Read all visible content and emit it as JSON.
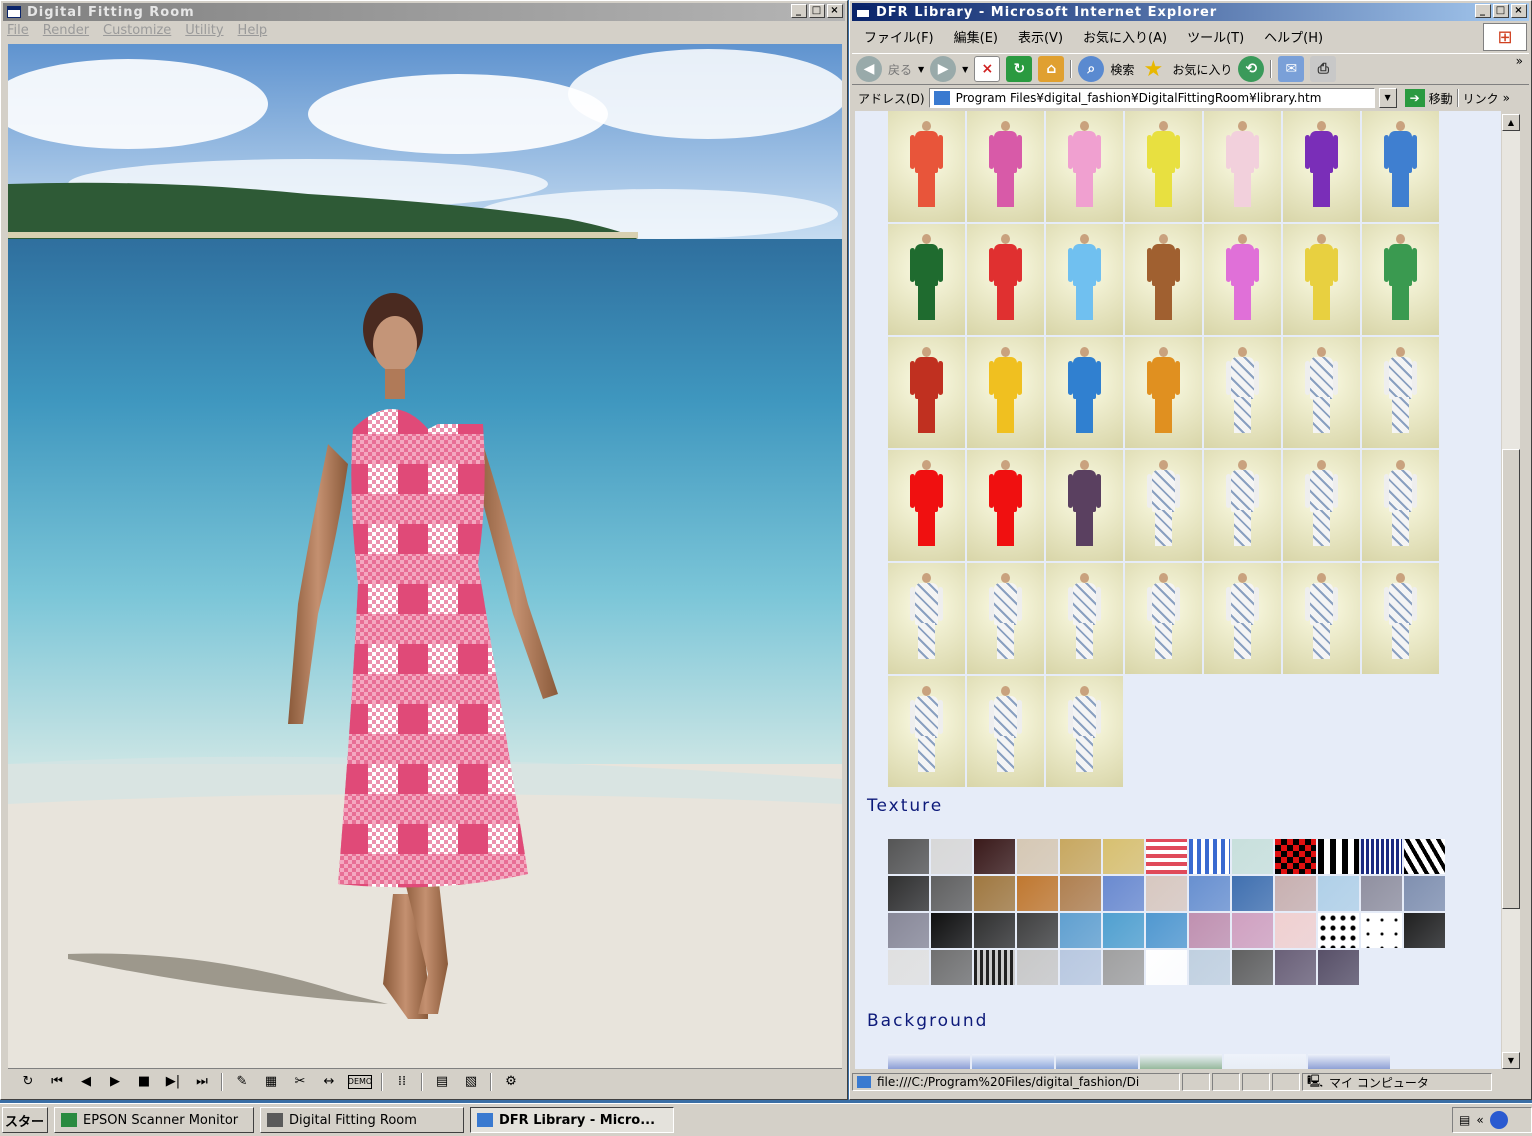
{
  "left_window": {
    "title": "Digital Fitting Room",
    "menu": [
      "File",
      "Render",
      "Customize",
      "Utility",
      "Help"
    ],
    "toolbar_icons": [
      "loop-icon",
      "rewind-start-icon",
      "step-back-icon",
      "play-icon",
      "stop-icon",
      "step-forward-icon",
      "fast-forward-end-icon",
      "eyedropper-icon",
      "grid-icon",
      "pattern-icon",
      "measure-icon",
      "demo-icon",
      "dotted-grid-icon",
      "tile-grid-icon",
      "settings-grid-icon",
      "wardrobe-icon"
    ],
    "demo_label": "DEMO"
  },
  "ie_window": {
    "title": "DFR Library - Microsoft Internet Explorer",
    "menu": [
      "ファイル(F)",
      "編集(E)",
      "表示(V)",
      "お気に入り(A)",
      "ツール(T)",
      "ヘルプ(H)"
    ],
    "toolbar": {
      "back_label": "戻る",
      "search_label": "検索",
      "favorites_label": "お気に入り"
    },
    "address_label": "アドレス(D)",
    "address_value": "Program Files¥digital_fashion¥DigitalFittingRoom¥library.htm",
    "go_label": "移動",
    "links_label": "リンク",
    "chevron": "»"
  },
  "library": {
    "garment_rows": [
      [
        "#e8553a",
        "#d85aa8",
        "#f0a0d0",
        "#e8e040",
        "#f2d0dc",
        "#7a2eb8",
        "#3f7fd0"
      ],
      [
        "#1f6b2f",
        "#e03030",
        "#70c0f0",
        "#a06030",
        "#e070d8",
        "#e8d040",
        "#3a9a50"
      ],
      [
        "#c03020",
        "#f0c020",
        "#3080d0",
        "#e09020",
        "#f4f4f4",
        "#f4f4f4",
        "#f4f4f4"
      ],
      [
        "#f01010",
        "#f01010",
        "#5a4060",
        "#f4f4f4",
        "#f4f4f4",
        "#f4f4f4",
        "#f4f4f4"
      ],
      [
        "#f4f4f4",
        "#f4f4f4",
        "#f4f4f4",
        "#f4f4f4",
        "#f4f4f4",
        "#f4f4f4",
        "#f4f4f4"
      ],
      [
        "#f4f4f4",
        "#f4f4f4",
        "#f4f4f4"
      ]
    ],
    "texture_heading": "Texture",
    "textures": [
      "#555555",
      "#d8d8d8",
      "#3a1a1a",
      "#d6c8b4",
      "#c8a860",
      "#d8c070",
      "stripe-red",
      "stripe-blue",
      "#c8e0dc",
      "check-red",
      "stripe-bw",
      "stripe-navy",
      "zebra",
      "#303030",
      "#606060",
      "#a07840",
      "#c07830",
      "#b08050",
      "#6a8ad0",
      "#d8c8c0",
      "#6890d0",
      "#4070b0",
      "#c8b0b0",
      "#b0d0e8",
      "#9090a0",
      "#8090b0",
      "#888898",
      "#101010",
      "#303030",
      "#404040",
      "#60a0d0",
      "#50a0d0",
      "#5098d0",
      "#c090b0",
      "#d0a0c0",
      "#f0d0d0",
      "dots-black",
      "dots-white",
      "#202020",
      "#e0e0e0",
      "#707070",
      "stripe-grey",
      "#c8c8c8",
      "#b8c8e0",
      "#a0a0a0",
      "#ffffff",
      "#c0d0e0",
      "#606060",
      "#6a6078",
      "#585068"
    ],
    "background_heading": "Background",
    "backgrounds": [
      "#2a4ab0",
      "#3060c0",
      "#2050a8",
      "#408040",
      "#e0e8f0",
      "#3050b0"
    ]
  },
  "statusbar": {
    "url": "file:///C:/Program%20Files/digital_fashion/Di",
    "zone": "マイ コンピュータ"
  },
  "taskbar": {
    "start": "スタート",
    "items": [
      "EPSON Scanner Monitor",
      "Digital Fitting Room",
      "DFR Library - Micro..."
    ],
    "tray_chevron": "«"
  }
}
